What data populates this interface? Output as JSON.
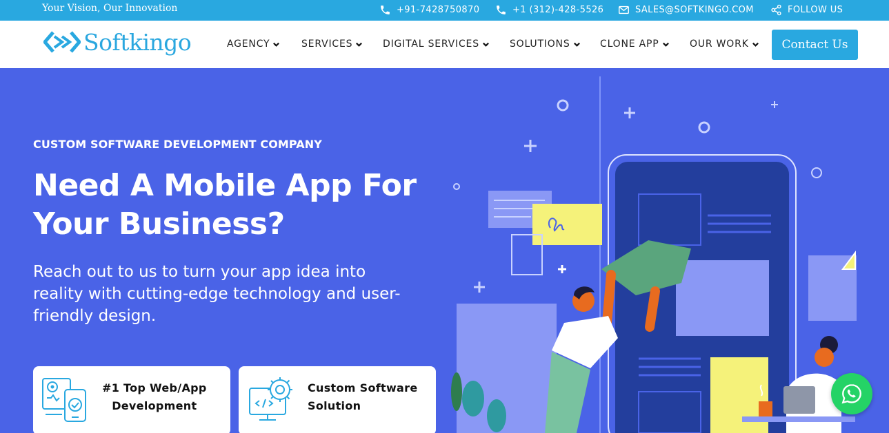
{
  "topbar": {
    "tagline": "Your Vision, Our Innovation",
    "phone_india": "+91-7428750870",
    "phone_us": "+1 (312)-428-5526",
    "email": "SALES@SOFTKINGO.COM",
    "follow": "FOLLOW US"
  },
  "nav": {
    "logo": "Softkingo",
    "items": [
      {
        "label": "AGENCY"
      },
      {
        "label": "SERVICES"
      },
      {
        "label": "DIGITAL SERVICES"
      },
      {
        "label": "SOLUTIONS"
      },
      {
        "label": "CLONE APP"
      },
      {
        "label": "OUR WORK"
      }
    ],
    "cta": "Contact Us"
  },
  "hero": {
    "eyebrow": "CUSTOM SOFTWARE DEVELOPMENT COMPANY",
    "headline": "Need A Mobile App For Your Business?",
    "subtext": "Reach out to us to turn your app idea into reality with cutting-edge technology and user-friendly design.",
    "cards": [
      {
        "line1": "#1 Top Web/App",
        "line2": "Development"
      },
      {
        "line1": "Custom Software",
        "line2": "Solution"
      }
    ]
  },
  "colors": {
    "brand": "#29a8e0",
    "hero_bg": "#4a63e7",
    "whatsapp": "#25d366"
  }
}
